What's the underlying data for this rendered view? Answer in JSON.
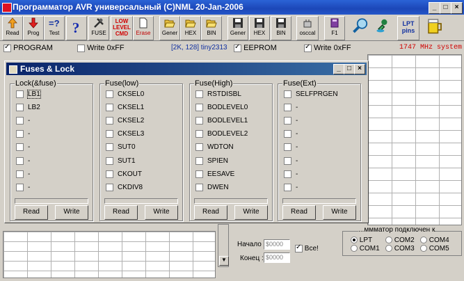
{
  "window": {
    "title": "Программатор AVR универсальный (C)NML 20-Jan-2006"
  },
  "toolbar": [
    {
      "label": "Read",
      "icon": "arrow-up-icon"
    },
    {
      "label": "Prog",
      "icon": "arrow-down-icon"
    },
    {
      "label": "Test",
      "icon": "test-icon"
    },
    {
      "label": "",
      "icon": "help-icon"
    },
    {
      "label": "FUSE",
      "icon": "tools-icon"
    },
    {
      "label": "LOW LEVEL CMD",
      "icon": "low-level-icon"
    },
    {
      "label": "Erase",
      "icon": "page-icon"
    },
    {
      "label": "Gener",
      "icon": "folder-open-icon"
    },
    {
      "label": "HEX",
      "icon": "folder-open-icon"
    },
    {
      "label": "BIN",
      "icon": "folder-open-icon"
    },
    {
      "label": "Gener",
      "icon": "floppy-icon"
    },
    {
      "label": "HEX",
      "icon": "floppy-icon"
    },
    {
      "label": "BIN",
      "icon": "floppy-icon"
    },
    {
      "label": "osccal",
      "icon": "osccal-icon"
    },
    {
      "label": "F1",
      "icon": "book-icon"
    },
    {
      "label": "",
      "icon": "magnifier-icon"
    },
    {
      "label": "",
      "icon": "stamp-icon"
    },
    {
      "label": "LPT pins",
      "icon": "lpt-pins-icon"
    },
    {
      "label": "",
      "icon": "beer-icon"
    }
  ],
  "options": {
    "program": "PROGRAM",
    "write_ff_left": "Write 0xFF",
    "chip_info": "[2K, 128]  tiny2313",
    "eeprom": "EEPROM",
    "write_ff_right": "Write 0xFF",
    "system_info": "1747 MHz system"
  },
  "dialog": {
    "title": "Fuses & Lock",
    "groups": [
      {
        "title": "Lock(&fuse)",
        "items": [
          "LB1",
          "LB2",
          "-",
          "-",
          "-",
          "-",
          "-",
          "-"
        ]
      },
      {
        "title": "Fuse(low)",
        "items": [
          "CKSEL0",
          "CKSEL1",
          "CKSEL2",
          "CKSEL3",
          "SUT0",
          "SUT1",
          "CKOUT",
          "CKDIV8"
        ]
      },
      {
        "title": "Fuse(High)",
        "items": [
          "RSTDISBL",
          "BODLEVEL0",
          "BODLEVEL1",
          "BODLEVEL2",
          "WDTON",
          "SPIEN",
          "EESAVE",
          "DWEN"
        ]
      },
      {
        "title": "Fuse(Ext)",
        "items": [
          "SELFPRGEN",
          "-",
          "-",
          "-",
          "-",
          "-",
          "-",
          "-"
        ]
      }
    ],
    "read_label": "Read",
    "write_label": "Write"
  },
  "range": {
    "start_label": "Начало :",
    "start_value": "$0000",
    "end_label": "Конец :",
    "end_value": "$0000",
    "all_label": "Все!"
  },
  "port": {
    "title": "...ммматор подключен к",
    "options": [
      "LPT",
      "COM2",
      "COM4",
      "COM1",
      "COM3",
      "COM5"
    ],
    "selected": "LPT"
  }
}
